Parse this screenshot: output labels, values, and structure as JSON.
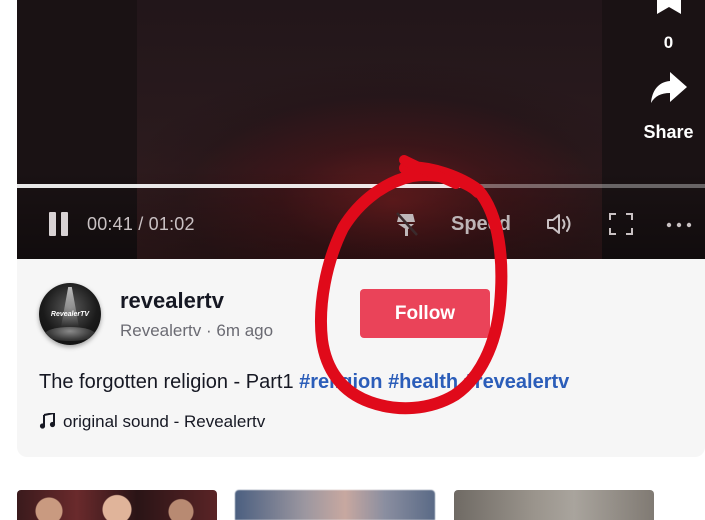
{
  "player": {
    "time": "00:41 / 01:02",
    "progress_fraction": 0.67,
    "speed_label": "Speed"
  },
  "actions": {
    "bookmark_count": "0",
    "share_label": "Share"
  },
  "author": {
    "username": "revealertv",
    "subline": "Revealertv · 6m ago",
    "avatar_text": "RevealerTV"
  },
  "follow_button": {
    "label": "Follow"
  },
  "caption": {
    "text": "The forgotten religion - Part1 ",
    "hashtags": [
      "#religion",
      "#health",
      "#revealertv"
    ]
  },
  "sound": {
    "label": "original sound - Revealertv"
  },
  "colors": {
    "follow_red": "#ea4359",
    "hashtag_blue": "#2b5db9",
    "annotation_red": "#e00a1a"
  }
}
